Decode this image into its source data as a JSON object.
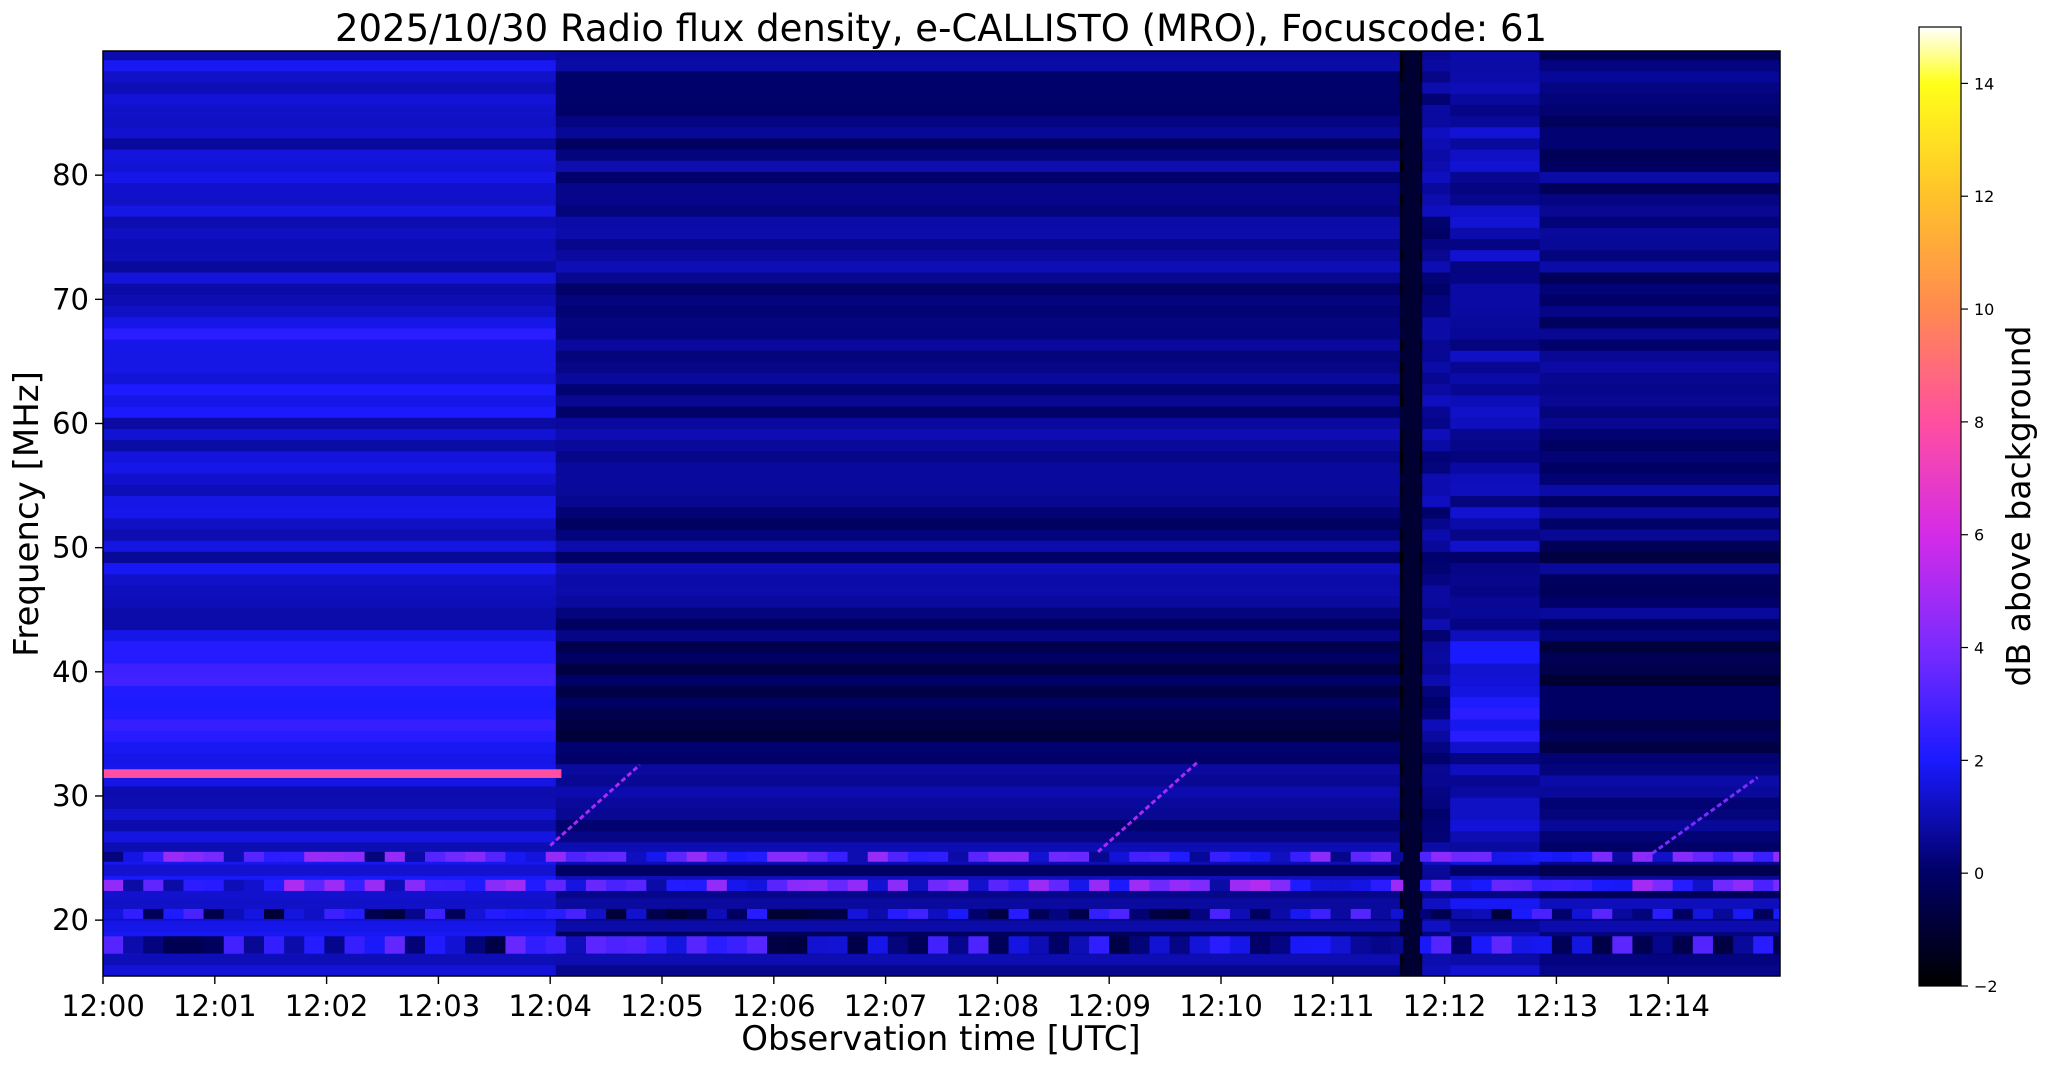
{
  "chart_data": {
    "type": "heatmap",
    "title": "2025/10/30  Radio flux density, e-CALLISTO (MRO), Focuscode: 61",
    "xlabel": "Observation time [UTC]",
    "ylabel": "Frequency [MHz]",
    "x_range_min": [
      0,
      15
    ],
    "xticks": [
      "12:00",
      "12:01",
      "12:02",
      "12:03",
      "12:04",
      "12:05",
      "12:06",
      "12:07",
      "12:08",
      "12:09",
      "12:10",
      "12:11",
      "12:12",
      "12:13",
      "12:14"
    ],
    "ylim": [
      15.5,
      90
    ],
    "yticks": [
      20,
      30,
      40,
      50,
      60,
      70,
      80
    ],
    "colorbar": {
      "label": "dB above background",
      "range": [
        -2,
        15
      ],
      "ticks": [
        -2,
        0,
        2,
        4,
        6,
        8,
        10,
        12,
        14
      ],
      "stops": [
        {
          "v": -2,
          "c": "#000000"
        },
        {
          "v": 0,
          "c": "#000066"
        },
        {
          "v": 2,
          "c": "#1a1aff"
        },
        {
          "v": 4,
          "c": "#7a2bff"
        },
        {
          "v": 6,
          "c": "#d42be8"
        },
        {
          "v": 8,
          "c": "#ff4fa0"
        },
        {
          "v": 10,
          "c": "#ff8a50"
        },
        {
          "v": 12,
          "c": "#ffc22a"
        },
        {
          "v": 14,
          "c": "#ffff1a"
        },
        {
          "v": 15,
          "c": "#ffffff"
        }
      ]
    },
    "features": [
      {
        "name": "steady carrier",
        "freq_mhz": 31.8,
        "t_min": [
          0,
          4.1
        ],
        "db": 8
      },
      {
        "name": "drifting signal 1",
        "t_min": [
          4.0,
          4.8
        ],
        "freq_mhz": [
          26,
          32.5
        ],
        "db": 5
      },
      {
        "name": "drifting signal 2",
        "t_min": [
          8.9,
          9.8
        ],
        "freq_mhz": [
          25.5,
          32.8
        ],
        "db": 5
      },
      {
        "name": "drifting signal 3",
        "t_min": [
          13.8,
          14.8
        ],
        "freq_mhz": [
          25,
          31.5
        ],
        "db": 4
      },
      {
        "name": "broadband dropout",
        "t_min": [
          11.63,
          11.78
        ],
        "db": -1
      }
    ]
  }
}
